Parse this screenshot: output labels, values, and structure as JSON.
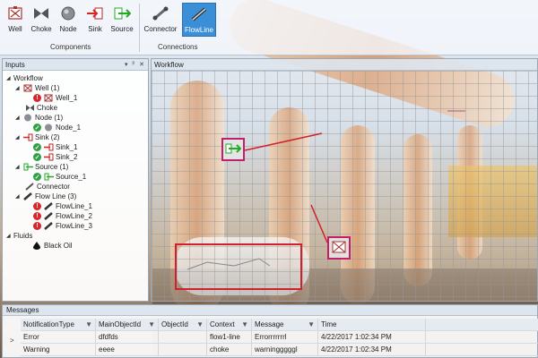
{
  "ribbon": {
    "buttons": [
      {
        "label": "Well",
        "icon": "well-icon"
      },
      {
        "label": "Choke",
        "icon": "choke-icon"
      },
      {
        "label": "Node",
        "icon": "node-icon"
      },
      {
        "label": "Sink",
        "icon": "sink-icon"
      },
      {
        "label": "Source",
        "icon": "source-icon"
      },
      {
        "label": "Connector",
        "icon": "connector-icon"
      },
      {
        "label": "FlowLine",
        "icon": "flowline-icon"
      }
    ],
    "groups": {
      "components": "Components",
      "connections": "Connections"
    },
    "active": "FlowLine"
  },
  "inputs": {
    "title": "Inputs",
    "controls": [
      "▾",
      "ᵖ",
      "✕"
    ],
    "tree": [
      {
        "label": "Workflow"
      },
      {
        "label": "Well (1)"
      },
      {
        "label": "Well_1",
        "status": "error"
      },
      {
        "label": "Choke"
      },
      {
        "label": "Node (1)"
      },
      {
        "label": "Node_1",
        "status": "ok"
      },
      {
        "label": "Sink (2)"
      },
      {
        "label": "Sink_1",
        "status": "ok"
      },
      {
        "label": "Sink_2",
        "status": "ok"
      },
      {
        "label": "Source (1)"
      },
      {
        "label": "Source_1",
        "status": "ok"
      },
      {
        "label": "Connector"
      },
      {
        "label": "Flow Line (3)"
      },
      {
        "label": "FlowLine_1",
        "status": "error"
      },
      {
        "label": "FlowLine_2",
        "status": "error"
      },
      {
        "label": "FlowLine_3",
        "status": "error"
      },
      {
        "label": "Fluids"
      },
      {
        "label": "Black Oil"
      }
    ]
  },
  "workflow": {
    "title": "Workflow"
  },
  "messages": {
    "title": "Messages",
    "columns": [
      "NotificationType",
      "MainObjectId",
      "ObjectId",
      "Context",
      "Message",
      "Time"
    ],
    "rows": [
      [
        "Error",
        "dfdfds",
        "",
        "flow1-line",
        "Errorrrrrrrl",
        "4/22/2017 1:02:34 PM"
      ],
      [
        "Warning",
        "eeee",
        "",
        "choke",
        "warningggggl",
        "4/22/2017 1:02:34 PM"
      ]
    ]
  },
  "colors": {
    "accent": "#3b8fd6",
    "error": "#d9262c",
    "ok": "#2ea043",
    "selection": "#d0202a"
  }
}
